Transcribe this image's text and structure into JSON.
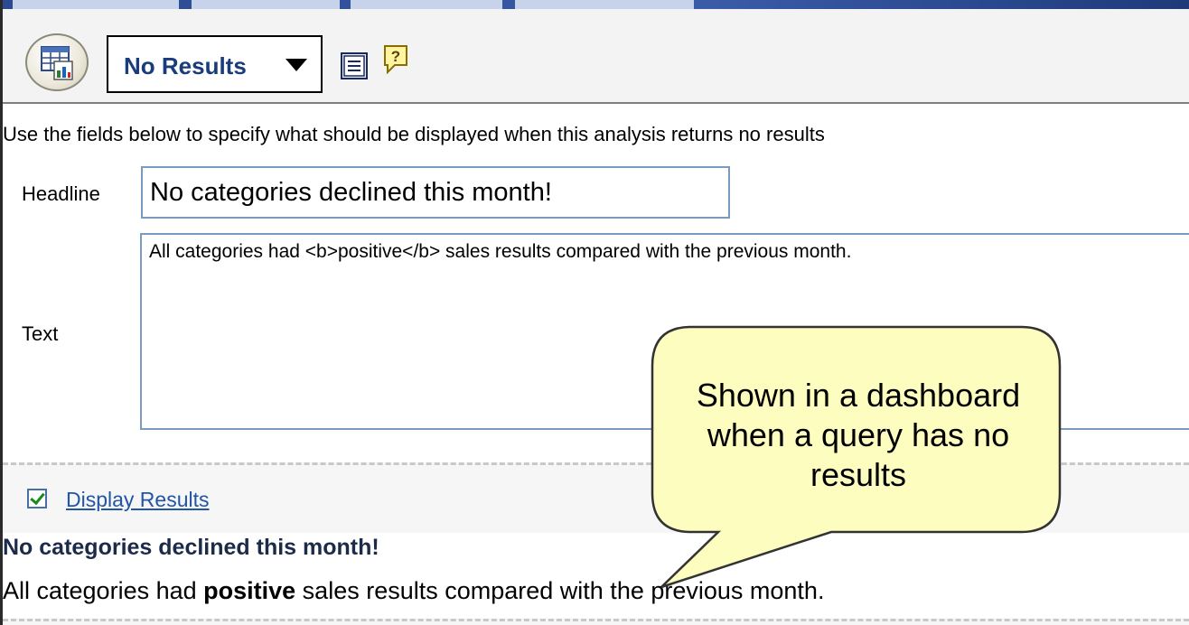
{
  "toolbar": {
    "view_selector_label": "No Results",
    "view_icon": "table-chart-view-icon",
    "properties_icon": "view-properties-icon",
    "help_icon": "help-icon"
  },
  "editor": {
    "instructions": "Use the fields below to specify what should be displayed when this analysis returns no results",
    "headline_label": "Headline",
    "headline_value": "No categories declined this month!",
    "text_label": "Text",
    "text_value": "All categories had <b>positive</b> sales results compared with the previous month."
  },
  "preview": {
    "display_results_label": "Display Results",
    "display_results_checked": true,
    "result_headline": "No categories declined this month!",
    "result_text_before": "All categories had ",
    "result_text_bold": "positive",
    "result_text_after": " sales results compared with the previous month."
  },
  "callout": {
    "text": "Shown in a dashboard when a query has no results",
    "fill_color": "#fdfdc0",
    "stroke_color": "#333333"
  },
  "colors": {
    "toolbar_bg": "#f3f3f3",
    "link": "#2255a5",
    "input_border": "#7b9ac0",
    "headline_text": "#1c2b48"
  }
}
